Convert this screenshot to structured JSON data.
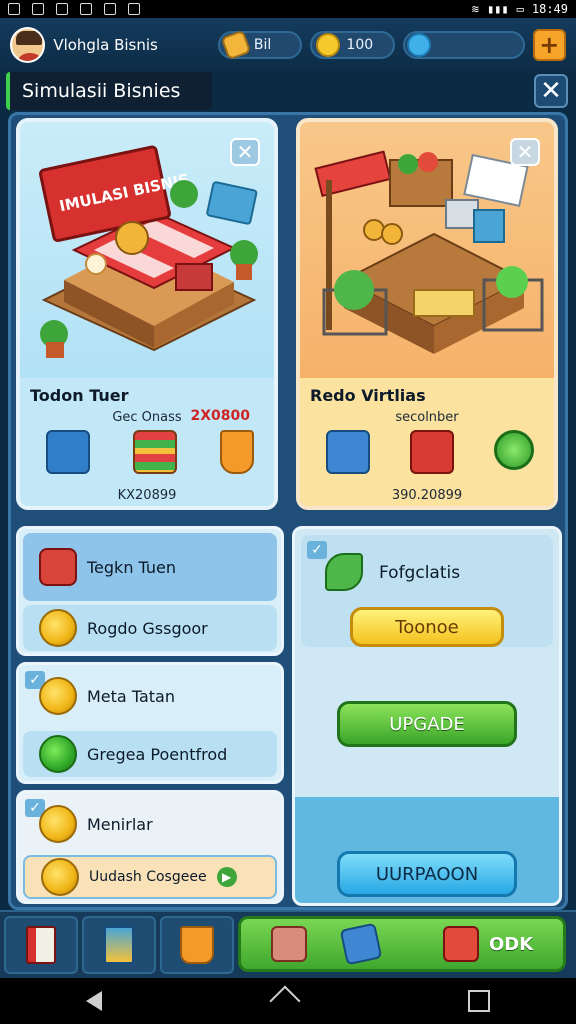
{
  "status_bar": {
    "time": "18:49"
  },
  "hud": {
    "player_name": "Vlohgla Bisnis",
    "cash_label": "Bil",
    "coins_value": "100",
    "gem_value": "",
    "plus_label": "+"
  },
  "screen_title": "Simulasii  Bisnies",
  "close_label": "✕",
  "cards": [
    {
      "title": "Todon Tuer",
      "subtitle": "Gec Onass",
      "extra": "2X0800",
      "amount": "KX20899",
      "sign_text": "IMULASI BISNIS",
      "items": [
        "blue-box-icon",
        "book-stack-icon",
        "cup-icon"
      ]
    },
    {
      "title": "Redo Virtlias",
      "subtitle": "secolnber",
      "extra": "",
      "amount": "390.20899",
      "sign_text": "",
      "items": [
        "blue-crate-icon",
        "red-crate-icon",
        "green-coin-icon"
      ]
    }
  ],
  "rows": {
    "group1": [
      "Tegkn Tuen",
      "Rogdo Gssgoor"
    ],
    "group2": [
      "Meta Tatan",
      "Gregea Poentfrod"
    ],
    "group3": [
      "Menirlar",
      "Uudash Cosgeee"
    ]
  },
  "right_panel": {
    "title": "Fofgclatis",
    "yellow_button": "Toonoe",
    "green_button": "UPGADE",
    "blue_button": "UURPAOON"
  },
  "bottom_bar": {
    "action_label": "ODK"
  }
}
